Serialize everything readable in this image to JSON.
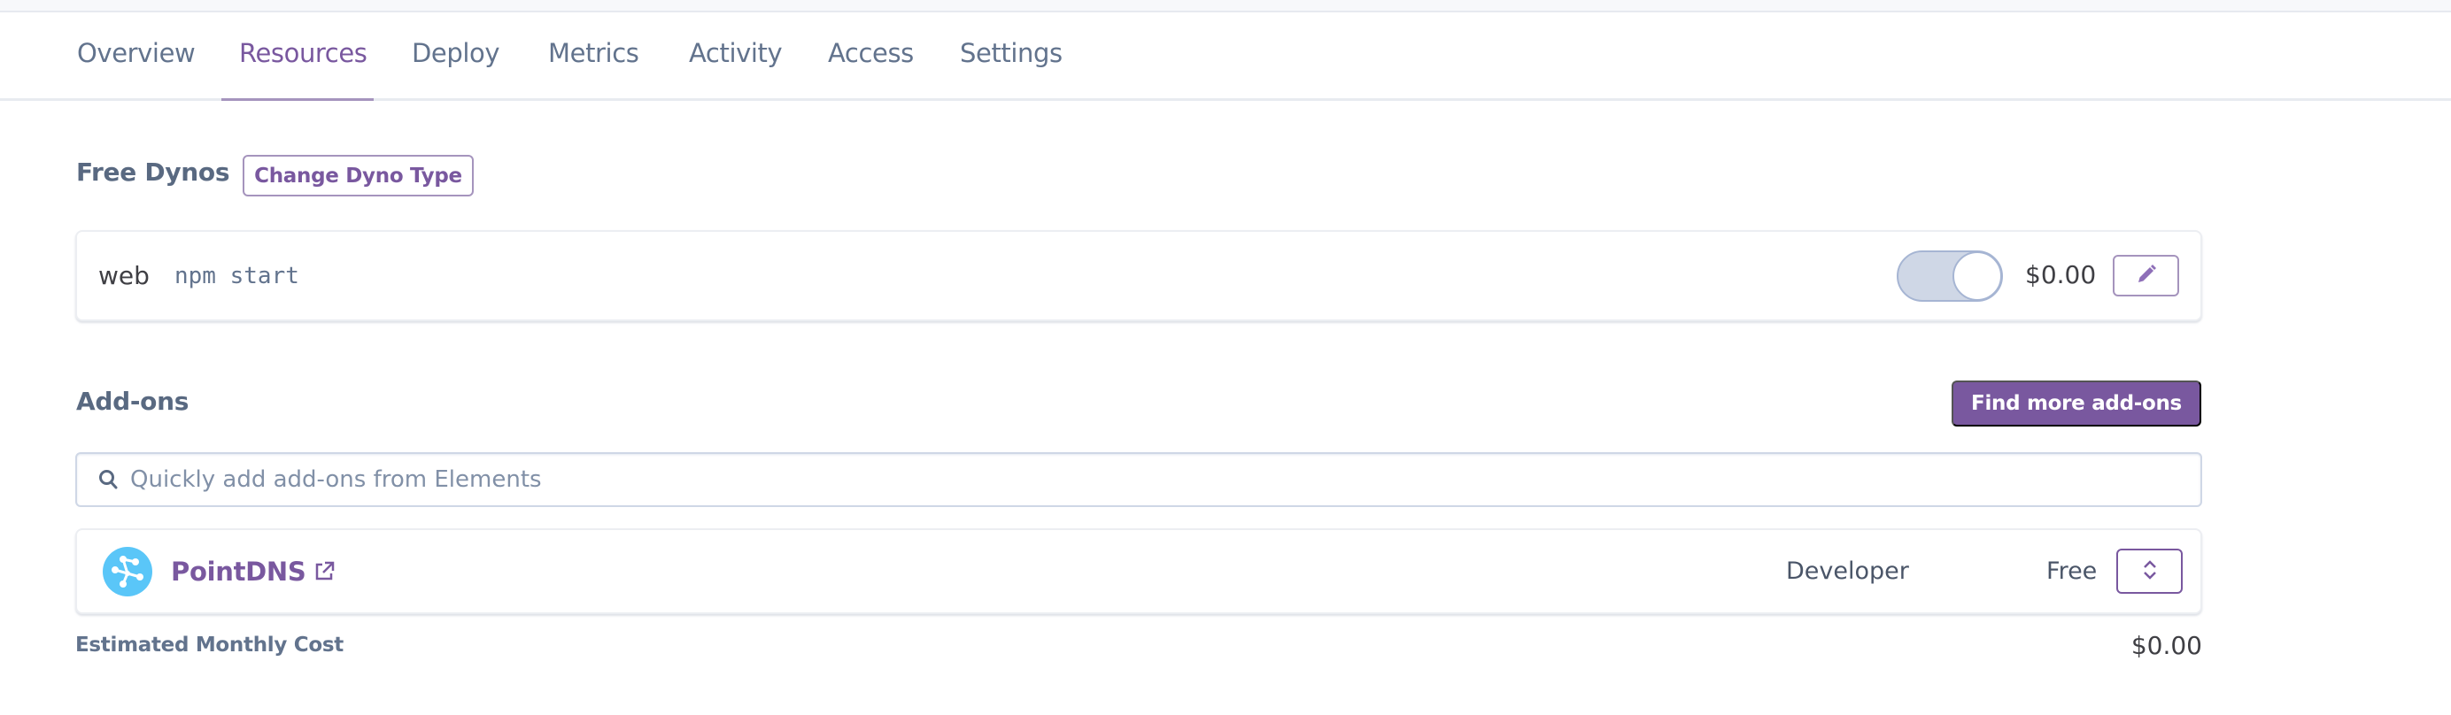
{
  "tabs": [
    {
      "label": "Overview",
      "active": false
    },
    {
      "label": "Resources",
      "active": true
    },
    {
      "label": "Deploy",
      "active": false
    },
    {
      "label": "Metrics",
      "active": false
    },
    {
      "label": "Activity",
      "active": false
    },
    {
      "label": "Access",
      "active": false
    },
    {
      "label": "Settings",
      "active": false
    }
  ],
  "dynos": {
    "heading": "Free Dynos",
    "change_type_label": "Change Dyno Type",
    "items": [
      {
        "name": "web",
        "command": "npm start",
        "enabled": true,
        "cost": "$0.00",
        "edit_icon": "pencil-icon"
      }
    ]
  },
  "addons": {
    "heading": "Add-ons",
    "find_more_label": "Find more add-ons",
    "search": {
      "placeholder": "Quickly add add-ons from Elements",
      "value": "",
      "icon": "search-icon"
    },
    "items": [
      {
        "name": "PointDNS",
        "logo_icon": "pointdns-logo-icon",
        "link_icon": "external-link-icon",
        "plan": "Developer",
        "price": "Free",
        "action_icon": "chevron-up-down-icon"
      }
    ]
  },
  "estimate": {
    "label": "Estimated Monthly Cost",
    "value": "$0.00"
  },
  "colors": {
    "accent": "#79589f",
    "accent_light": "#a594bd",
    "text_muted": "#62738d",
    "addon_logo": "#5ac6f8"
  }
}
